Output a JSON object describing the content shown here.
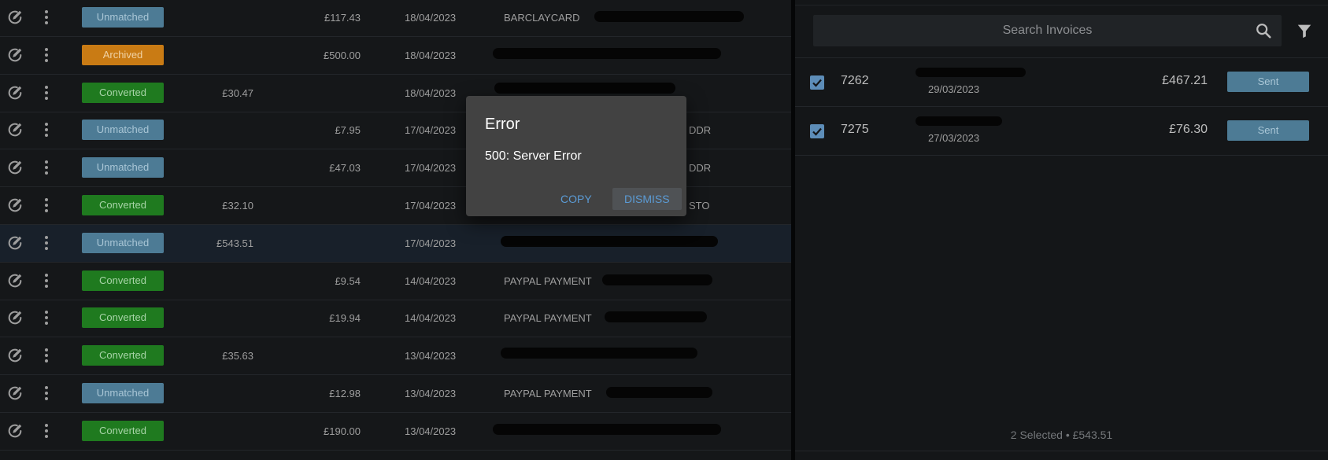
{
  "transactions": [
    {
      "status": "Unmatched",
      "status_type": "unmatched",
      "credit": "",
      "debit": "£117.43",
      "date": "18/04/2023",
      "description": "BARCLAYCARD",
      "description_extra": ""
    },
    {
      "status": "Archived",
      "status_type": "archived",
      "credit": "",
      "debit": "£500.00",
      "date": "18/04/2023",
      "description": "",
      "description_extra": ""
    },
    {
      "status": "Converted",
      "status_type": "converted",
      "credit": "£30.47",
      "debit": "",
      "date": "18/04/2023",
      "description": "",
      "description_extra": ""
    },
    {
      "status": "Unmatched",
      "status_type": "unmatched",
      "credit": "",
      "debit": "£7.95",
      "date": "17/04/2023",
      "description": "",
      "description_extra": "DDR"
    },
    {
      "status": "Unmatched",
      "status_type": "unmatched",
      "credit": "",
      "debit": "£47.03",
      "date": "17/04/2023",
      "description": "",
      "description_extra": "DDR"
    },
    {
      "status": "Converted",
      "status_type": "converted",
      "credit": "£32.10",
      "debit": "",
      "date": "17/04/2023",
      "description": "",
      "description_extra": "STO"
    },
    {
      "status": "Unmatched",
      "status_type": "unmatched",
      "credit": "£543.51",
      "debit": "",
      "date": "17/04/2023",
      "description": "",
      "description_extra": ""
    },
    {
      "status": "Converted",
      "status_type": "converted",
      "credit": "",
      "debit": "£9.54",
      "date": "14/04/2023",
      "description": "PAYPAL PAYMENT",
      "description_extra": ""
    },
    {
      "status": "Converted",
      "status_type": "converted",
      "credit": "",
      "debit": "£19.94",
      "date": "14/04/2023",
      "description": "PAYPAL PAYMENT",
      "description_extra": ""
    },
    {
      "status": "Converted",
      "status_type": "converted",
      "credit": "£35.63",
      "debit": "",
      "date": "13/04/2023",
      "description": "",
      "description_extra": ""
    },
    {
      "status": "Unmatched",
      "status_type": "unmatched",
      "credit": "",
      "debit": "£12.98",
      "date": "13/04/2023",
      "description": "PAYPAL PAYMENT",
      "description_extra": ""
    },
    {
      "status": "Converted",
      "status_type": "converted",
      "credit": "",
      "debit": "£190.00",
      "date": "13/04/2023",
      "description": "",
      "description_extra": ""
    }
  ],
  "search": {
    "placeholder": "Search Invoices",
    "icon": "search-icon",
    "filter_icon": "filter-icon"
  },
  "invoices": [
    {
      "number": "7262",
      "date": "29/03/2023",
      "amount": "£467.21",
      "status": "Sent",
      "checked": true
    },
    {
      "number": "7275",
      "date": "27/03/2023",
      "amount": "£76.30",
      "status": "Sent",
      "checked": true
    }
  ],
  "footer": {
    "summary": "2 Selected • £543.51"
  },
  "dialog": {
    "title": "Error",
    "message": "500: Server Error",
    "copy_label": "COPY",
    "dismiss_label": "DISMISS"
  },
  "colors": {
    "unmatched": "#4d7b95",
    "archived": "#c97b14",
    "converted": "#1f7a1f",
    "accent": "#5b9bd5"
  }
}
